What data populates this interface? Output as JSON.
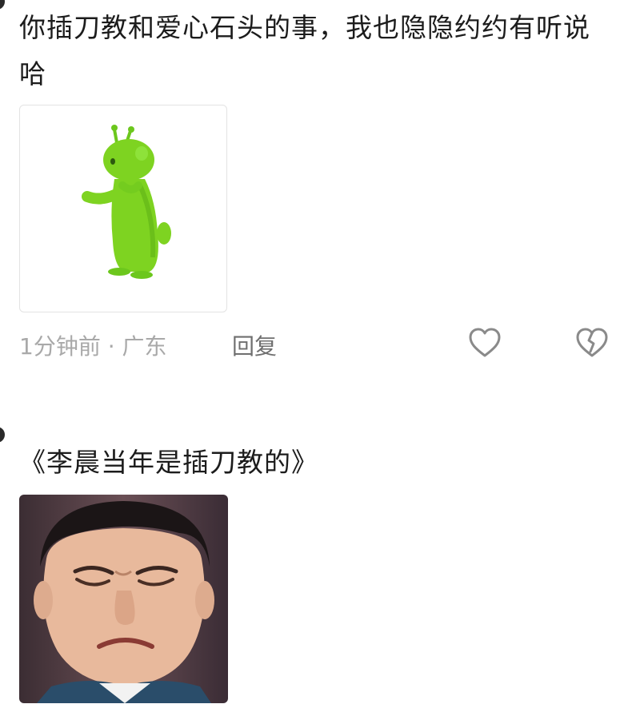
{
  "comments": [
    {
      "text": "你插刀教和爱心石头的事，我也隐隐约约有听说哈",
      "sticker_icon": "green-alien-sticker",
      "meta": {
        "time": "1分钟前",
        "separator": " · ",
        "location": "广东",
        "reply_label": "回复"
      },
      "like_icon": "heart-outline-icon",
      "dislike_icon": "broken-heart-icon"
    },
    {
      "text": "《李晨当年是插刀教的》",
      "image_icon": "grimacing-face-photo"
    }
  ],
  "colors": {
    "meta_text": "#a9a9a9",
    "reply_text": "#6f6f6f",
    "icon_stroke": "#8a8a8a",
    "sticker_green": "#7ed321"
  }
}
